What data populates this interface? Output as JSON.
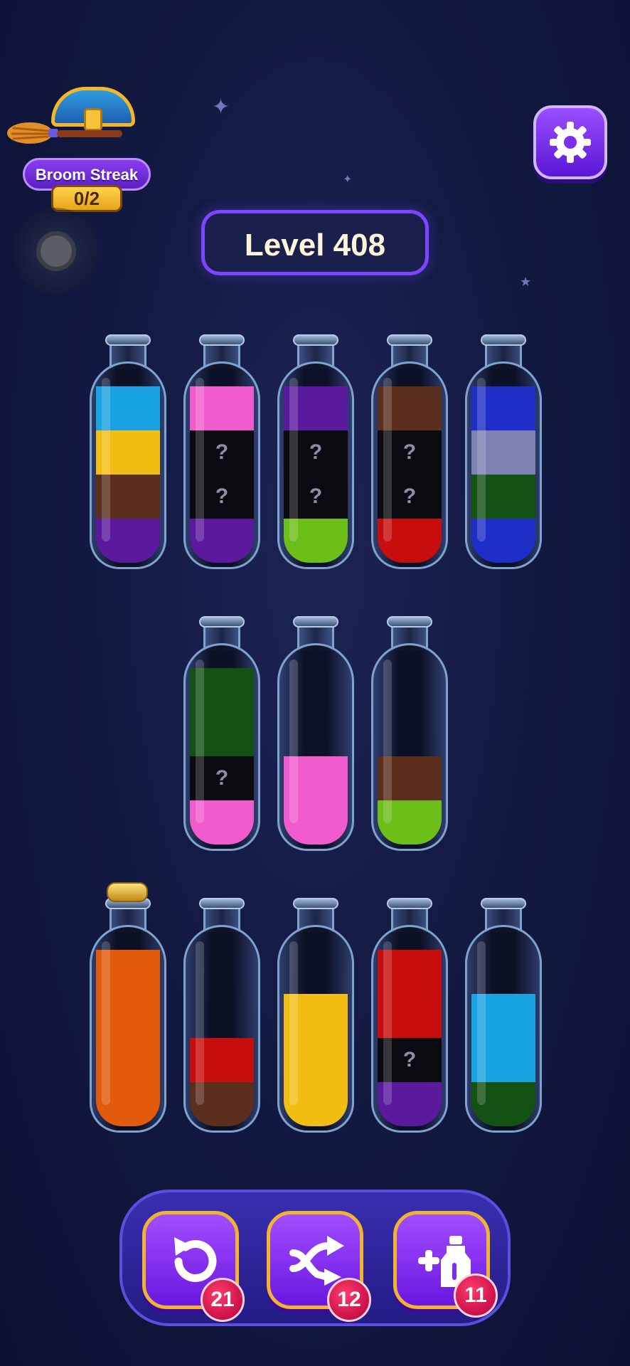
{
  "streak": {
    "label": "Broom Streak",
    "count": "0/2",
    "icon": "treasure-chest-broom"
  },
  "level": {
    "label": "Level 408"
  },
  "settings": {
    "icon": "gear-icon"
  },
  "colors": {
    "cyan": "#1aa3e3",
    "yellow": "#f2be13",
    "brown": "#5c2e1d",
    "purple": "#5b1a9e",
    "pink": "#f05ccd",
    "hidden": "#0a0a10",
    "lime": "#6cbe18",
    "red": "#c80d0d",
    "blue": "#1e2fc7",
    "slate": "#7d82b3",
    "dkgreen": "#145214",
    "orange": "#e25a0b"
  },
  "bottles": [
    {
      "id": "b1",
      "layers": [
        "purple",
        "brown",
        "yellow",
        "cyan"
      ]
    },
    {
      "id": "b2",
      "layers": [
        "purple",
        "hidden",
        "hidden",
        "pink"
      ]
    },
    {
      "id": "b3",
      "layers": [
        "lime",
        "hidden",
        "hidden",
        "purple"
      ]
    },
    {
      "id": "b4",
      "layers": [
        "red",
        "hidden",
        "hidden",
        "brown"
      ]
    },
    {
      "id": "b5",
      "layers": [
        "blue",
        "dkgreen",
        "slate",
        "blue"
      ]
    },
    {
      "id": "b6",
      "layers": [
        "pink",
        "hidden",
        "dkgreen",
        "dkgreen"
      ]
    },
    {
      "id": "b7",
      "layers": [
        "pink",
        "pink"
      ]
    },
    {
      "id": "b8",
      "layers": [
        "lime",
        "brown"
      ]
    },
    {
      "id": "b9",
      "layers": [
        "orange",
        "orange",
        "orange",
        "orange"
      ],
      "corked": true
    },
    {
      "id": "b10",
      "layers": [
        "brown",
        "red"
      ]
    },
    {
      "id": "b11",
      "layers": [
        "yellow",
        "yellow",
        "yellow"
      ]
    },
    {
      "id": "b12",
      "layers": [
        "purple",
        "hidden",
        "red",
        "red"
      ]
    },
    {
      "id": "b13",
      "layers": [
        "dkgreen",
        "cyan",
        "cyan"
      ]
    }
  ],
  "hidden_mark": "?",
  "boosters": [
    {
      "name": "undo",
      "icon": "undo-icon",
      "count": "21"
    },
    {
      "name": "shuffle",
      "icon": "shuffle-icon",
      "count": "12"
    },
    {
      "name": "add-bottle",
      "icon": "add-bottle-icon",
      "count": "11"
    }
  ]
}
